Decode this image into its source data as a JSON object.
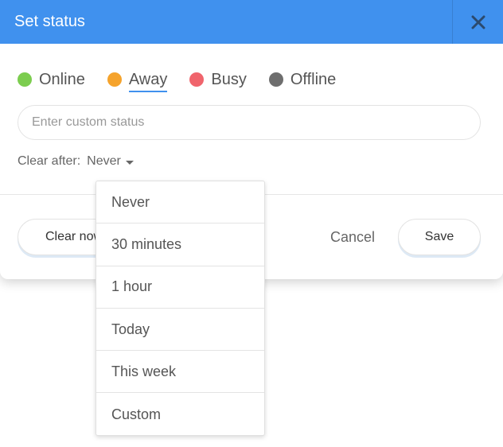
{
  "dialog": {
    "title": "Set status"
  },
  "statuses": [
    {
      "label": "Online",
      "color": "#7ccd4f",
      "selected": false
    },
    {
      "label": "Away",
      "color": "#f5a32c",
      "selected": true
    },
    {
      "label": "Busy",
      "color": "#f0646c",
      "selected": false
    },
    {
      "label": "Offline",
      "color": "#6e6e6e",
      "selected": false
    }
  ],
  "custom_status": {
    "placeholder": "Enter custom status",
    "value": ""
  },
  "clear_after": {
    "label": "Clear after:",
    "selected": "Never",
    "options": [
      "Never",
      "30 minutes",
      "1 hour",
      "Today",
      "This week",
      "Custom"
    ]
  },
  "footer": {
    "clear_now_label": "Clear now",
    "cancel_label": "Cancel",
    "save_label": "Save"
  },
  "colors": {
    "accent": "#4091ee"
  }
}
